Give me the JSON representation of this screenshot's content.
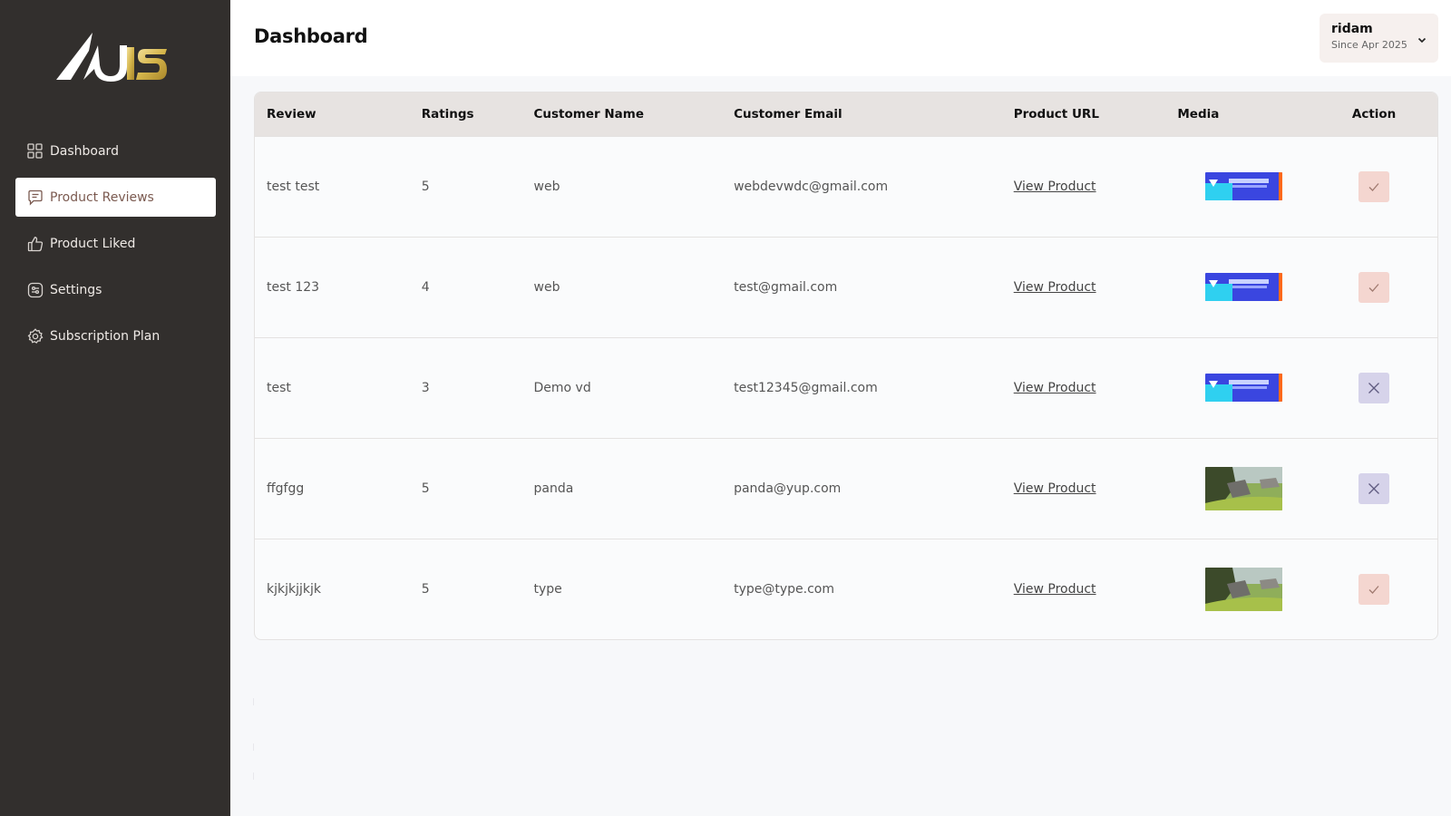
{
  "sidebar": {
    "logo_text": "U15",
    "items": [
      {
        "label": "Dashboard",
        "icon": "grid-icon",
        "active": false
      },
      {
        "label": "Product Reviews",
        "icon": "message-square-icon",
        "active": true
      },
      {
        "label": "Product Liked",
        "icon": "thumbs-up-icon",
        "active": false
      },
      {
        "label": "Settings",
        "icon": "sliders-icon",
        "active": false
      },
      {
        "label": "Subscription Plan",
        "icon": "gear-icon",
        "active": false
      }
    ]
  },
  "header": {
    "title": "Dashboard",
    "user": {
      "name": "ridam",
      "since": "Since Apr 2025",
      "dropdown_icon": "chevron-down-icon"
    }
  },
  "table": {
    "columns": [
      "Review",
      "Ratings",
      "Customer Name",
      "Customer Email",
      "Product URL",
      "Media",
      "Action"
    ],
    "rows": [
      {
        "review": "test test",
        "rating": "5",
        "customer_name": "web",
        "email": "webdevwdc@gmail.com",
        "url_label": "View Product",
        "media": "banner-thumbnail",
        "action": "approve",
        "action_icon": "check-icon"
      },
      {
        "review": "test 123",
        "rating": "4",
        "customer_name": "web",
        "email": "test@gmail.com",
        "url_label": "View Product",
        "media": "banner-thumbnail",
        "action": "approve",
        "action_icon": "check-icon"
      },
      {
        "review": "test",
        "rating": "3",
        "customer_name": "Demo vd",
        "email": "test12345@gmail.com",
        "url_label": "View Product",
        "media": "banner-thumbnail",
        "action": "reject",
        "action_icon": "close-icon"
      },
      {
        "review": "ffgfgg",
        "rating": "5",
        "customer_name": "panda",
        "email": "panda@yup.com",
        "url_label": "View Product",
        "media": "landscape-thumbnail",
        "action": "reject",
        "action_icon": "close-icon"
      },
      {
        "review": "kjkjkjjkjk",
        "rating": "5",
        "customer_name": "type",
        "email": "type@type.com",
        "url_label": "View Product",
        "media": "landscape-thumbnail",
        "action": "approve",
        "action_icon": "check-icon"
      }
    ]
  },
  "colors": {
    "sidebar_bg": "#322f2d",
    "active_item_text": "#7b5a50",
    "table_header_bg": "#e7e3e1",
    "approve_bg": "#f4d6d0",
    "reject_bg": "#d6d3ea",
    "logo_gold": "#d4b44a"
  }
}
